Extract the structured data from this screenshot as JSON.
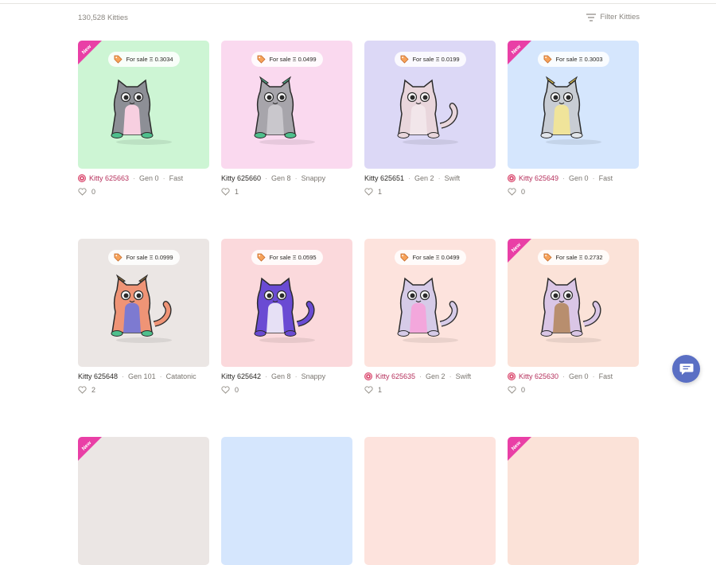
{
  "header": {
    "count_label": "130,528 Kitties",
    "filter_label": "Filter Kitties"
  },
  "cards": [
    {
      "bg": "#cdf5d4",
      "new": true,
      "price": "For sale  Ξ 0.3034",
      "name": "Kitty 625663",
      "gen": "Gen 0",
      "speed": "Fast",
      "likes": "0",
      "fancy": true,
      "body": "#8d8f96",
      "belly": "#f7cfe0",
      "accent": "#3f3f46",
      "feet": "#4fc08d",
      "tail": false,
      "horns": false
    },
    {
      "bg": "#fad9ef",
      "new": false,
      "price": "For sale  Ξ 0.0499",
      "name": "Kitty 625660",
      "gen": "Gen 8",
      "speed": "Snappy",
      "likes": "1",
      "fancy": false,
      "body": "#a7a5ab",
      "belly": "#c9c7cc",
      "accent": "#52b58d",
      "feet": "#4fc08d",
      "tail": false,
      "horns": true
    },
    {
      "bg": "#dcd8f6",
      "new": false,
      "price": "For sale  Ξ 0.0199",
      "name": "Kitty 625651",
      "gen": "Gen 2",
      "speed": "Swift",
      "likes": "1",
      "fancy": false,
      "body": "#e9d6dc",
      "belly": "#f2e6ea",
      "accent": "#8a5a57",
      "feet": "#e9d6dc",
      "tail": true,
      "horns": false
    },
    {
      "bg": "#d5e6fd",
      "new": true,
      "price": "For sale  Ξ 0.3003",
      "name": "Kitty 625649",
      "gen": "Gen 0",
      "speed": "Fast",
      "likes": "0",
      "fancy": true,
      "body": "#c8cdd4",
      "belly": "#f0e49a",
      "accent": "#e8c94c",
      "feet": "#e2e6ea",
      "tail": false,
      "horns": true
    },
    {
      "bg": "#ebe6e4",
      "new": false,
      "price": "For sale  Ξ 0.0999",
      "name": "Kitty 625648",
      "gen": "Gen 101",
      "speed": "Catatonic",
      "likes": "2",
      "fancy": false,
      "body": "#ef9476",
      "belly": "#7d7ad1",
      "accent": "#8a6a3a",
      "feet": "#4fc08d",
      "tail": true,
      "horns": true
    },
    {
      "bg": "#fbd9dc",
      "new": false,
      "price": "For sale  Ξ 0.0595",
      "name": "Kitty 625642",
      "gen": "Gen 8",
      "speed": "Snappy",
      "likes": "0",
      "fancy": false,
      "body": "#6a4bd3",
      "belly": "#e6e0f5",
      "accent": "#3b2a8f",
      "feet": "#6a4bd3",
      "tail": true,
      "horns": false
    },
    {
      "bg": "#fde3dd",
      "new": false,
      "price": "For sale  Ξ 0.0499",
      "name": "Kitty 625635",
      "gen": "Gen 2",
      "speed": "Swift",
      "likes": "1",
      "fancy": true,
      "body": "#d6cbe8",
      "belly": "#f3a7dc",
      "accent": "#b4a6cf",
      "feet": "#d6cbe8",
      "tail": true,
      "horns": false
    },
    {
      "bg": "#fbe2d8",
      "new": true,
      "price": "For sale  Ξ 0.2732",
      "name": "Kitty 625630",
      "gen": "Gen 0",
      "speed": "Fast",
      "likes": "0",
      "fancy": true,
      "body": "#dac6e6",
      "belly": "#b88e6e",
      "accent": "#b9a0cf",
      "feet": "#dac6e6",
      "tail": true,
      "horns": false
    },
    {
      "bg": "#ebe6e4",
      "new": true,
      "price": "",
      "name": "",
      "gen": "",
      "speed": "",
      "likes": "",
      "fancy": false,
      "body": "",
      "belly": "",
      "accent": "",
      "feet": "",
      "tail": false,
      "horns": false
    },
    {
      "bg": "#d5e6fd",
      "new": false,
      "price": "",
      "name": "",
      "gen": "",
      "speed": "",
      "likes": "",
      "fancy": false,
      "body": "",
      "belly": "",
      "accent": "",
      "feet": "",
      "tail": false,
      "horns": false
    },
    {
      "bg": "#fde3dd",
      "new": false,
      "price": "",
      "name": "",
      "gen": "",
      "speed": "",
      "likes": "",
      "fancy": false,
      "body": "",
      "belly": "",
      "accent": "",
      "feet": "",
      "tail": false,
      "horns": false
    },
    {
      "bg": "#fbe2d8",
      "new": true,
      "price": "",
      "name": "",
      "gen": "",
      "speed": "",
      "likes": "",
      "fancy": false,
      "body": "",
      "belly": "",
      "accent": "",
      "feet": "",
      "tail": false,
      "horns": false
    }
  ],
  "badges": {
    "new_label": "New"
  },
  "icons": {
    "filter": "filter-lines-icon",
    "tag": "price-tag-icon",
    "heart": "heart-outline-icon",
    "chat": "chat-bubble-icon"
  }
}
